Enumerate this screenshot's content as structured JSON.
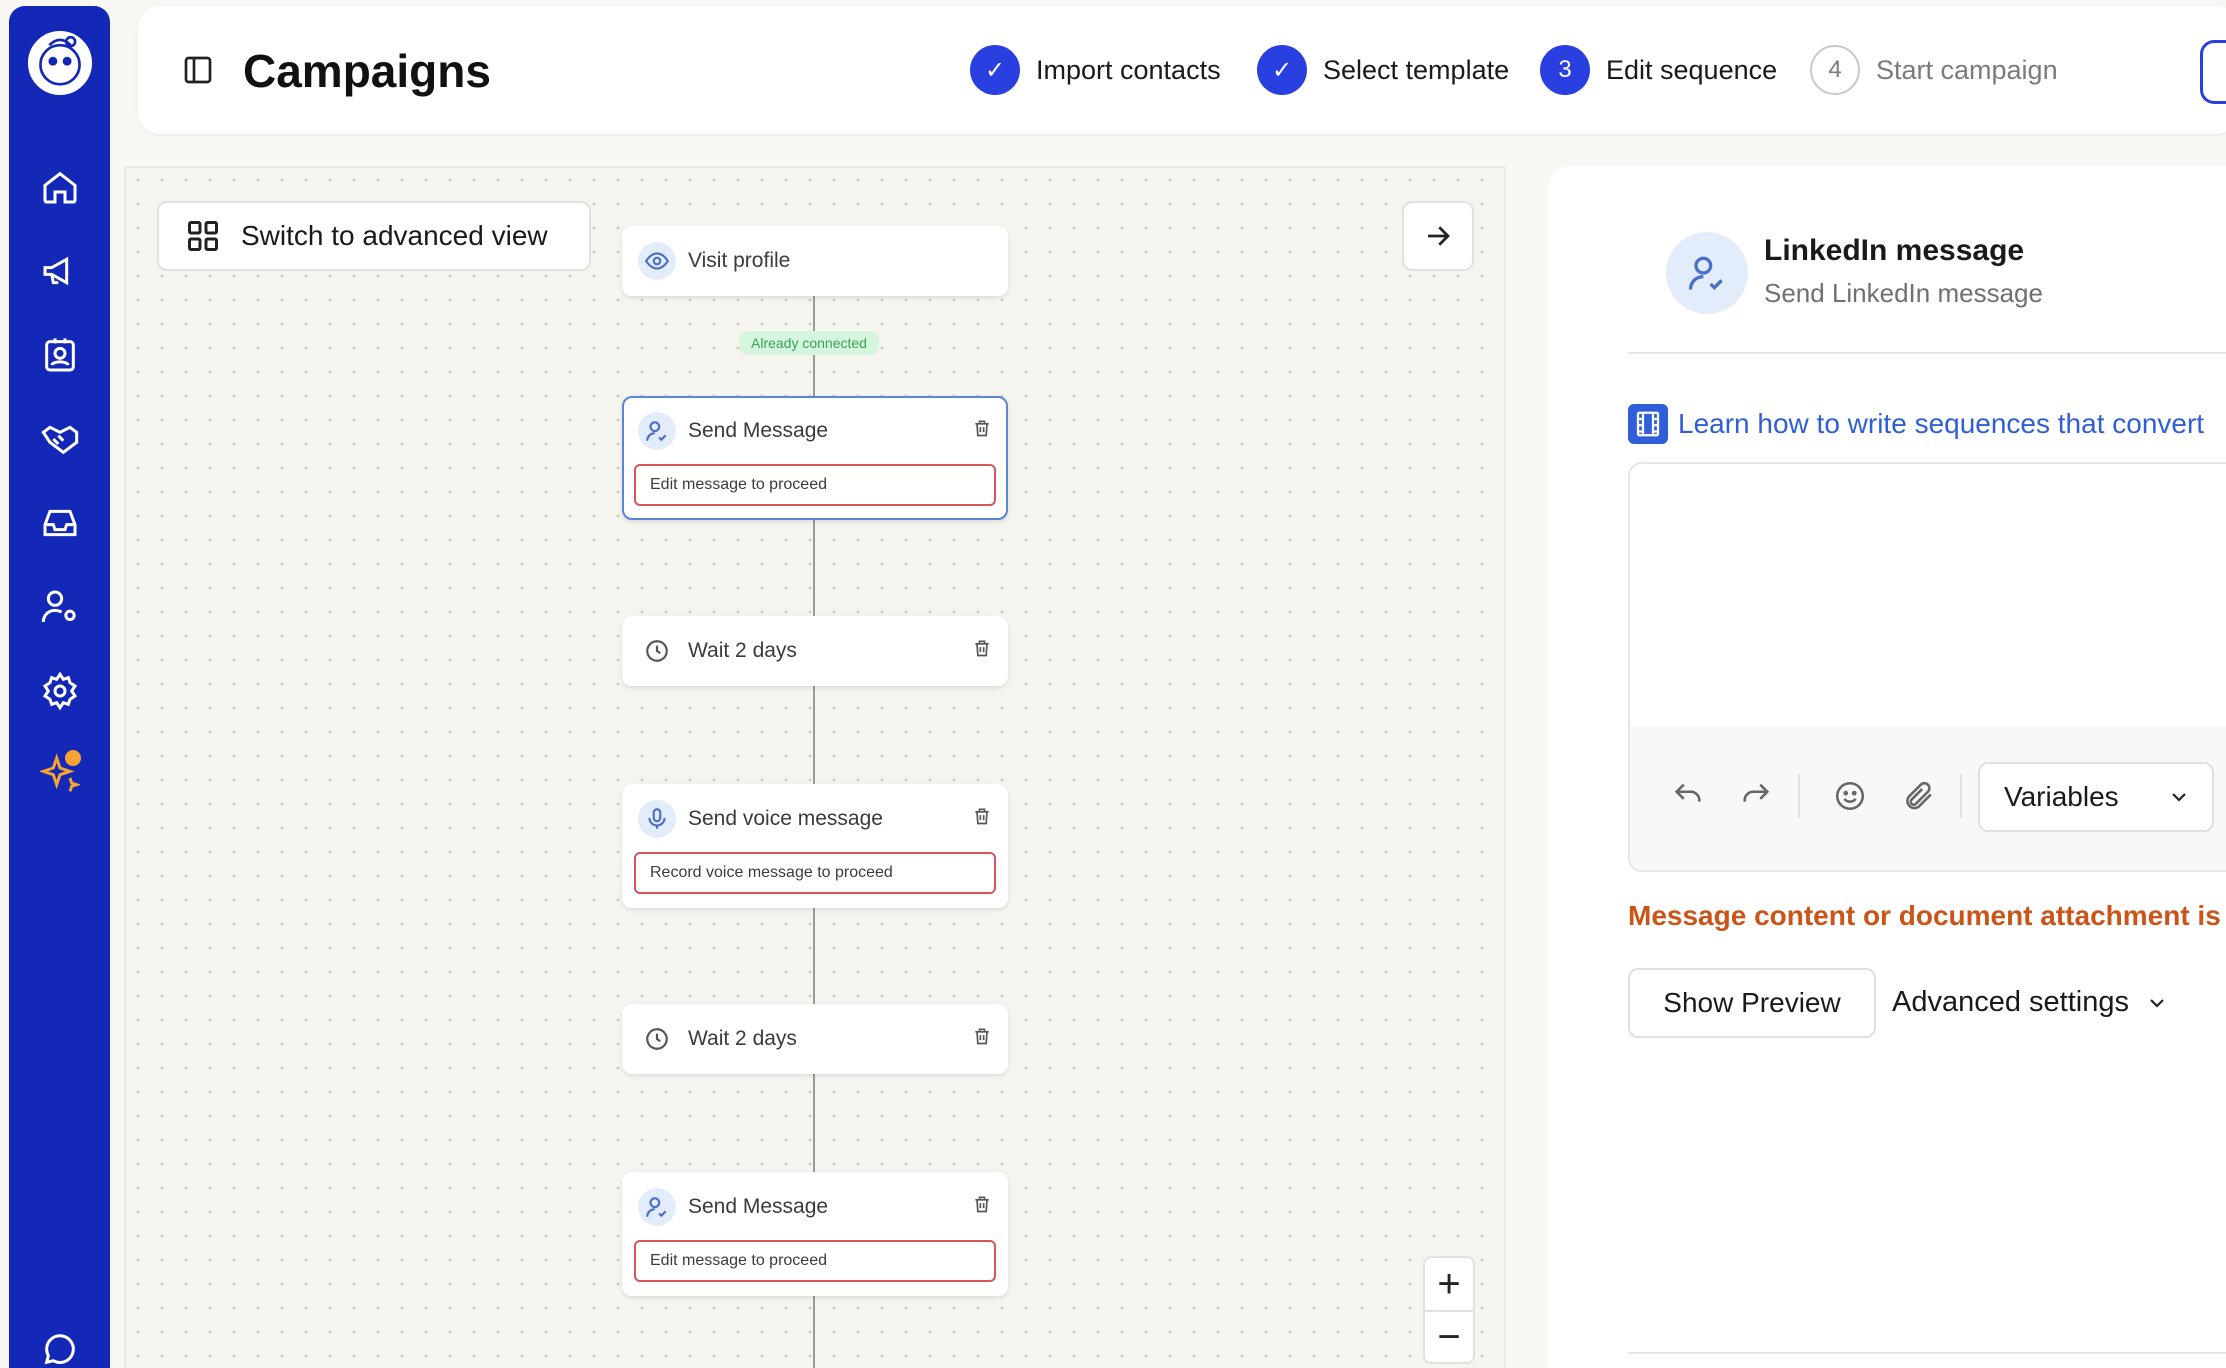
{
  "header": {
    "title": "Campaigns",
    "steps": [
      {
        "label": "Import contacts",
        "marker": "✓",
        "state": "done"
      },
      {
        "label": "Select template",
        "marker": "✓",
        "state": "done"
      },
      {
        "label": "Edit sequence",
        "marker": "3",
        "state": "current"
      },
      {
        "label": "Start campaign",
        "marker": "4",
        "state": "todo"
      }
    ]
  },
  "canvas": {
    "advanced_view_label": "Switch to advanced view",
    "connected_tag": "Already connected",
    "nodes": [
      {
        "label": "Visit profile",
        "icon": "eye-icon"
      },
      {
        "label": "Send Message",
        "icon": "user-check-icon",
        "warning": "Edit message to proceed"
      },
      {
        "label": "Wait 2 days",
        "icon": "clock-icon"
      },
      {
        "label": "Send voice message",
        "icon": "microphone-icon",
        "warning": "Record voice message to proceed"
      },
      {
        "label": "Wait 2 days",
        "icon": "clock-icon"
      },
      {
        "label": "Send Message",
        "icon": "user-check-icon",
        "warning": "Edit message to proceed"
      }
    ],
    "zoom_in": "+",
    "zoom_out": "−"
  },
  "panel": {
    "title": "LinkedIn message",
    "subtitle": "Send LinkedIn message",
    "learn_link": "Learn how to write sequences that convert",
    "variables_label": "Variables",
    "error": "Message content or document attachment is",
    "preview_label": "Show Preview",
    "advanced_label": "Advanced settings"
  },
  "colors": {
    "sidebar": "#1428b8",
    "accent": "#2a3fe0",
    "error": "#c95518",
    "warning_border": "#d9535a",
    "link": "#2f5ed8"
  }
}
